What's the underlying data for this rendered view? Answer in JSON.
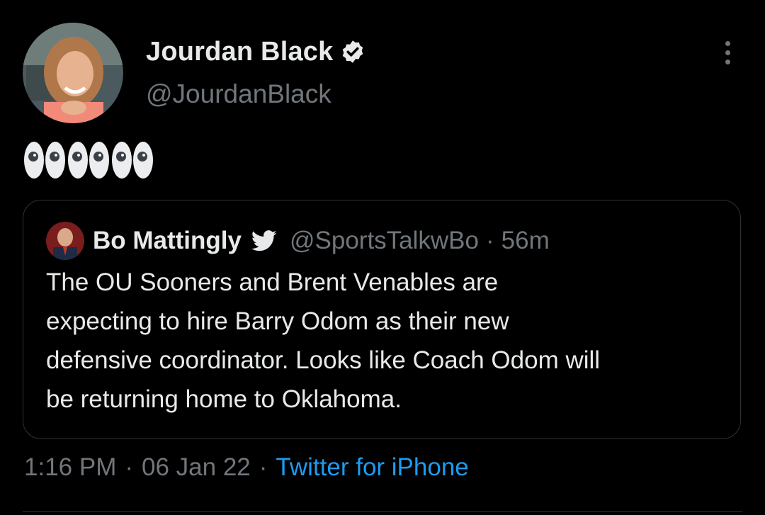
{
  "tweet": {
    "author": {
      "name": "Jourdan Black",
      "handle": "@JourdanBlack",
      "verified": true,
      "avatar_icon": "profile-photo"
    },
    "more_icon": "more-dots-icon",
    "text_emoji": "👀👀👀",
    "quoted": {
      "name": "Bo Mattingly",
      "handle": "@SportsTalkwBo",
      "separator": "·",
      "time": "56m",
      "badge_icon": "twitter-bird-icon",
      "body_lines": [
        "The OU Sooners and Brent Venables are",
        "expecting to hire Barry Odom as their new",
        "defensive coordinator. Looks like Coach Odom will",
        "be returning home to Oklahoma."
      ]
    },
    "meta": {
      "time": "1:16 PM",
      "separator": "·",
      "date": "06 Jan 22",
      "source": "Twitter for iPhone"
    }
  },
  "colors": {
    "background": "#000000",
    "primary_text": "#e7e9ea",
    "secondary_text": "#71767b",
    "link": "#1d9bf0",
    "border": "#2f3336"
  }
}
